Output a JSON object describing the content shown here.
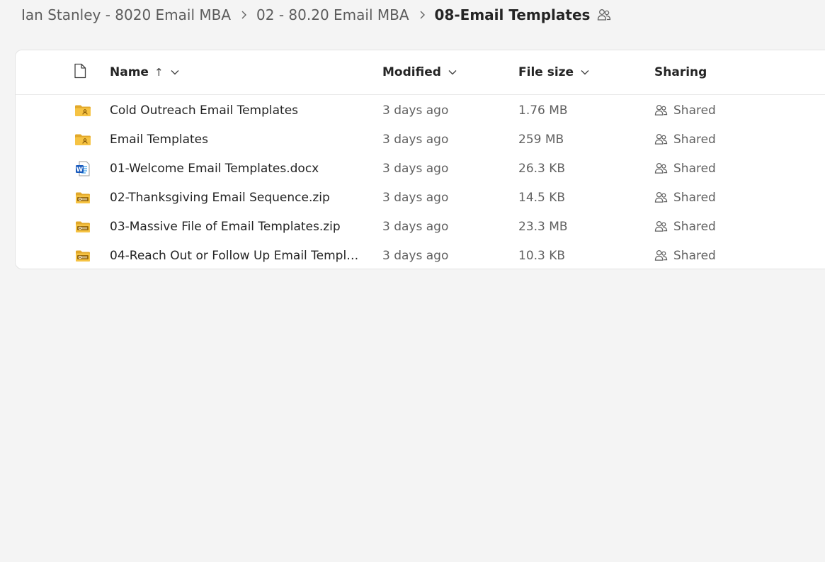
{
  "breadcrumb": {
    "items": [
      "Ian Stanley - 8020 Email MBA",
      "02 - 80.20 Email MBA"
    ],
    "current": "08-Email Templates"
  },
  "columns": {
    "name": "Name",
    "name_sort_arrow": "↑",
    "modified": "Modified",
    "file_size": "File size",
    "sharing": "Sharing"
  },
  "files": [
    {
      "icon": "shared-folder-icon",
      "name": "Cold Outreach Email Templates",
      "modified": "3 days ago",
      "size": "1.76 MB",
      "sharing": "Shared"
    },
    {
      "icon": "shared-folder-icon",
      "name": "Email Templates",
      "modified": "3 days ago",
      "size": "259 MB",
      "sharing": "Shared"
    },
    {
      "icon": "word-doc-icon",
      "name": "01-Welcome Email Templates.docx",
      "modified": "3 days ago",
      "size": "26.3 KB",
      "sharing": "Shared"
    },
    {
      "icon": "zip-folder-icon",
      "name": "02-Thanksgiving Email Sequence.zip",
      "modified": "3 days ago",
      "size": "14.5 KB",
      "sharing": "Shared"
    },
    {
      "icon": "zip-folder-icon",
      "name": "03-Massive File of Email Templates.zip",
      "modified": "3 days ago",
      "size": "23.3 MB",
      "sharing": "Shared"
    },
    {
      "icon": "zip-folder-icon",
      "name": "04-Reach Out or Follow Up Email Template...",
      "modified": "3 days ago",
      "size": "10.3 KB",
      "sharing": "Shared"
    }
  ],
  "colors": {
    "folder": "#f6c343",
    "folder_dark": "#e2a82a",
    "word_blue": "#185abd",
    "background": "#f4f4f4"
  }
}
